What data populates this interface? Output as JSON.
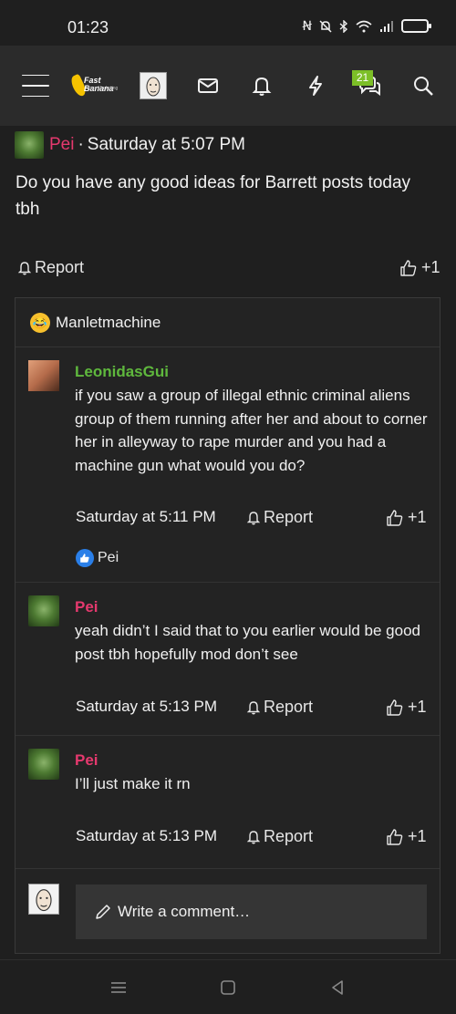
{
  "status_bar": {
    "time": "01:23"
  },
  "navbar": {
    "logo_text": "Fast Banana",
    "logo_sub": "Mass Marketing",
    "notifications_badge": "21"
  },
  "post": {
    "username": "Pei",
    "separator": "·",
    "timestamp": "Saturday at 5:07 PM",
    "body": "Do you have any good ideas for Barrett posts today tbh",
    "report_label": "Report",
    "like_label": "+1"
  },
  "comments_section": {
    "reacted_user": "Manletmachine",
    "comments": [
      {
        "username": "LeonidasGui",
        "text": "if you saw a group of illegal ethnic criminal aliens group of them running after her and about to corner her in alleyway to rape murder and you had a machine gun what would you do?",
        "timestamp": "Saturday at 5:11 PM",
        "report_label": "Report",
        "like_label": "+1",
        "liked_by": "Pei"
      },
      {
        "username": "Pei",
        "text": "yeah didn’t I said that to you earlier would be good post tbh hopefully mod don’t see",
        "timestamp": "Saturday at 5:13 PM",
        "report_label": "Report",
        "like_label": "+1"
      },
      {
        "username": "Pei",
        "text": "I’ll just make it rn",
        "timestamp": "Saturday at 5:13 PM",
        "report_label": "Report",
        "like_label": "+1"
      }
    ],
    "write_placeholder": "Write a comment…"
  },
  "colors": {
    "accent_pink": "#e5396e",
    "accent_green": "#5fb83d",
    "like_blue": "#2a7fe8",
    "badge_green": "#7cbf27"
  }
}
